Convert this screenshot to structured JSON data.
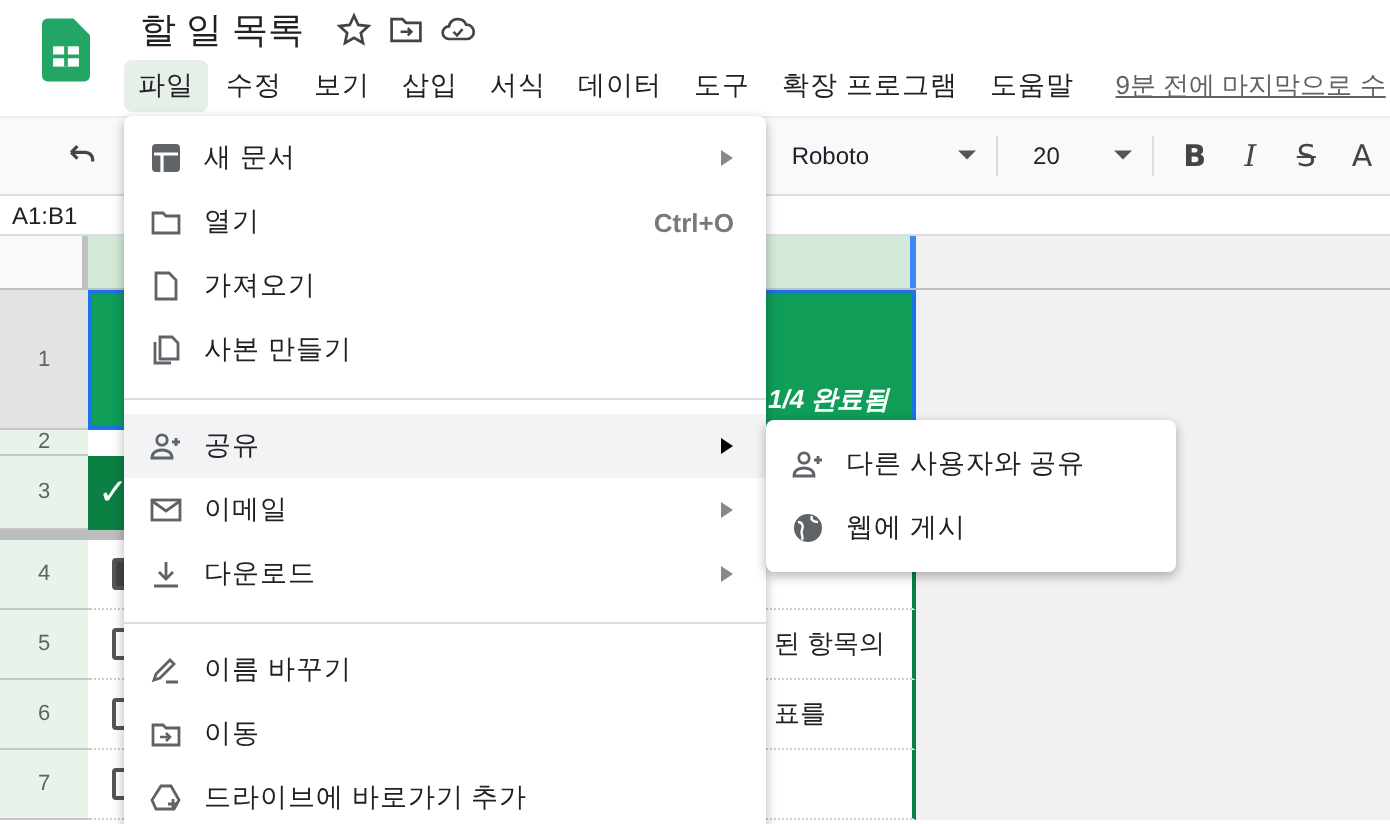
{
  "header": {
    "title": "할 일 목록",
    "last_edit": "9분 전에 마지막으로 수",
    "menus": [
      {
        "label": "파일",
        "selected": true
      },
      {
        "label": "수정",
        "selected": false
      },
      {
        "label": "보기",
        "selected": false
      },
      {
        "label": "삽입",
        "selected": false
      },
      {
        "label": "서식",
        "selected": false
      },
      {
        "label": "데이터",
        "selected": false
      },
      {
        "label": "도구",
        "selected": false
      },
      {
        "label": "확장 프로그램",
        "selected": false
      },
      {
        "label": "도움말",
        "selected": false
      }
    ]
  },
  "toolbar": {
    "font": "Roboto",
    "font_size": "20",
    "format_buttons": [
      "B",
      "I",
      "S",
      "A"
    ]
  },
  "name_box": "A1:B1",
  "sheet": {
    "rows": [
      {
        "number": "1",
        "kind": "banner",
        "status": "1/4 완료됨"
      },
      {
        "number": "2",
        "kind": "spacer"
      },
      {
        "number": "3",
        "kind": "heading",
        "mark": "✓"
      },
      {
        "number": "4",
        "kind": "task",
        "checked": true
      },
      {
        "number": "5",
        "kind": "task",
        "checked": false,
        "text": "된 항목의"
      },
      {
        "number": "6",
        "kind": "task",
        "checked": false,
        "text": "표를"
      },
      {
        "number": "7",
        "kind": "task",
        "checked": false
      }
    ]
  },
  "file_menu": {
    "items": [
      {
        "kind": "item",
        "label": "새 문서",
        "submenu": true,
        "selected": false
      },
      {
        "kind": "item",
        "label": "열기",
        "shortcut": "Ctrl+O",
        "submenu": false,
        "selected": false
      },
      {
        "kind": "item",
        "label": "가져오기",
        "submenu": false,
        "selected": false
      },
      {
        "kind": "item",
        "label": "사본 만들기",
        "submenu": false,
        "selected": false
      },
      {
        "kind": "divider"
      },
      {
        "kind": "item",
        "label": "공유",
        "submenu": true,
        "selected": true
      },
      {
        "kind": "item",
        "label": "이메일",
        "submenu": true,
        "selected": false
      },
      {
        "kind": "item",
        "label": "다운로드",
        "submenu": true,
        "selected": false
      },
      {
        "kind": "divider"
      },
      {
        "kind": "item",
        "label": "이름 바꾸기",
        "submenu": false,
        "selected": false
      },
      {
        "kind": "item",
        "label": "이동",
        "submenu": false,
        "selected": false
      },
      {
        "kind": "item",
        "label": "드라이브에 바로가기 추가",
        "submenu": false,
        "selected": false
      }
    ]
  },
  "share_submenu": {
    "items": [
      {
        "label": "다른 사용자와 공유"
      },
      {
        "label": "웹에 게시"
      }
    ]
  }
}
